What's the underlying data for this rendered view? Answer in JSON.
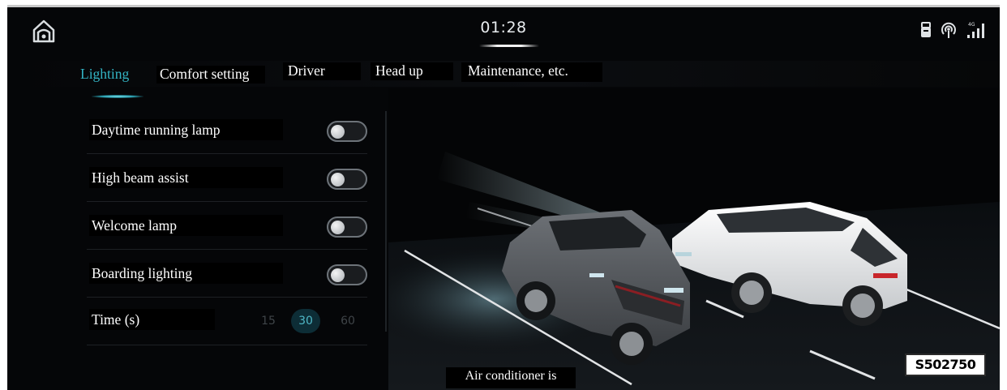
{
  "status_bar": {
    "time": "01:28",
    "icons": [
      "home-icon",
      "usb-icon",
      "wireless-icon",
      "4g-signal-icon"
    ],
    "signal_label": "4G"
  },
  "tabs": [
    {
      "label": "Lighting",
      "active": true
    },
    {
      "label": "Comfort setting",
      "active": false
    },
    {
      "label": "Driver",
      "active": false
    },
    {
      "label": "Head up",
      "active": false
    },
    {
      "label": "Maintenance, etc.",
      "active": false
    }
  ],
  "settings": [
    {
      "label": "Daytime running lamp",
      "on": false
    },
    {
      "label": "High beam assist",
      "on": false
    },
    {
      "label": "Welcome lamp",
      "on": false
    },
    {
      "label": "Boarding lighting",
      "on": false
    }
  ],
  "time_setting": {
    "label": "Time (s)",
    "options": [
      "15",
      "30",
      "60"
    ],
    "selected": "30"
  },
  "bottom_note": "Air conditioner is",
  "figure_code": "S502750",
  "colors": {
    "accent": "#33b4c4",
    "background": "#050608",
    "selected_option_bg": "#0d2d36"
  }
}
